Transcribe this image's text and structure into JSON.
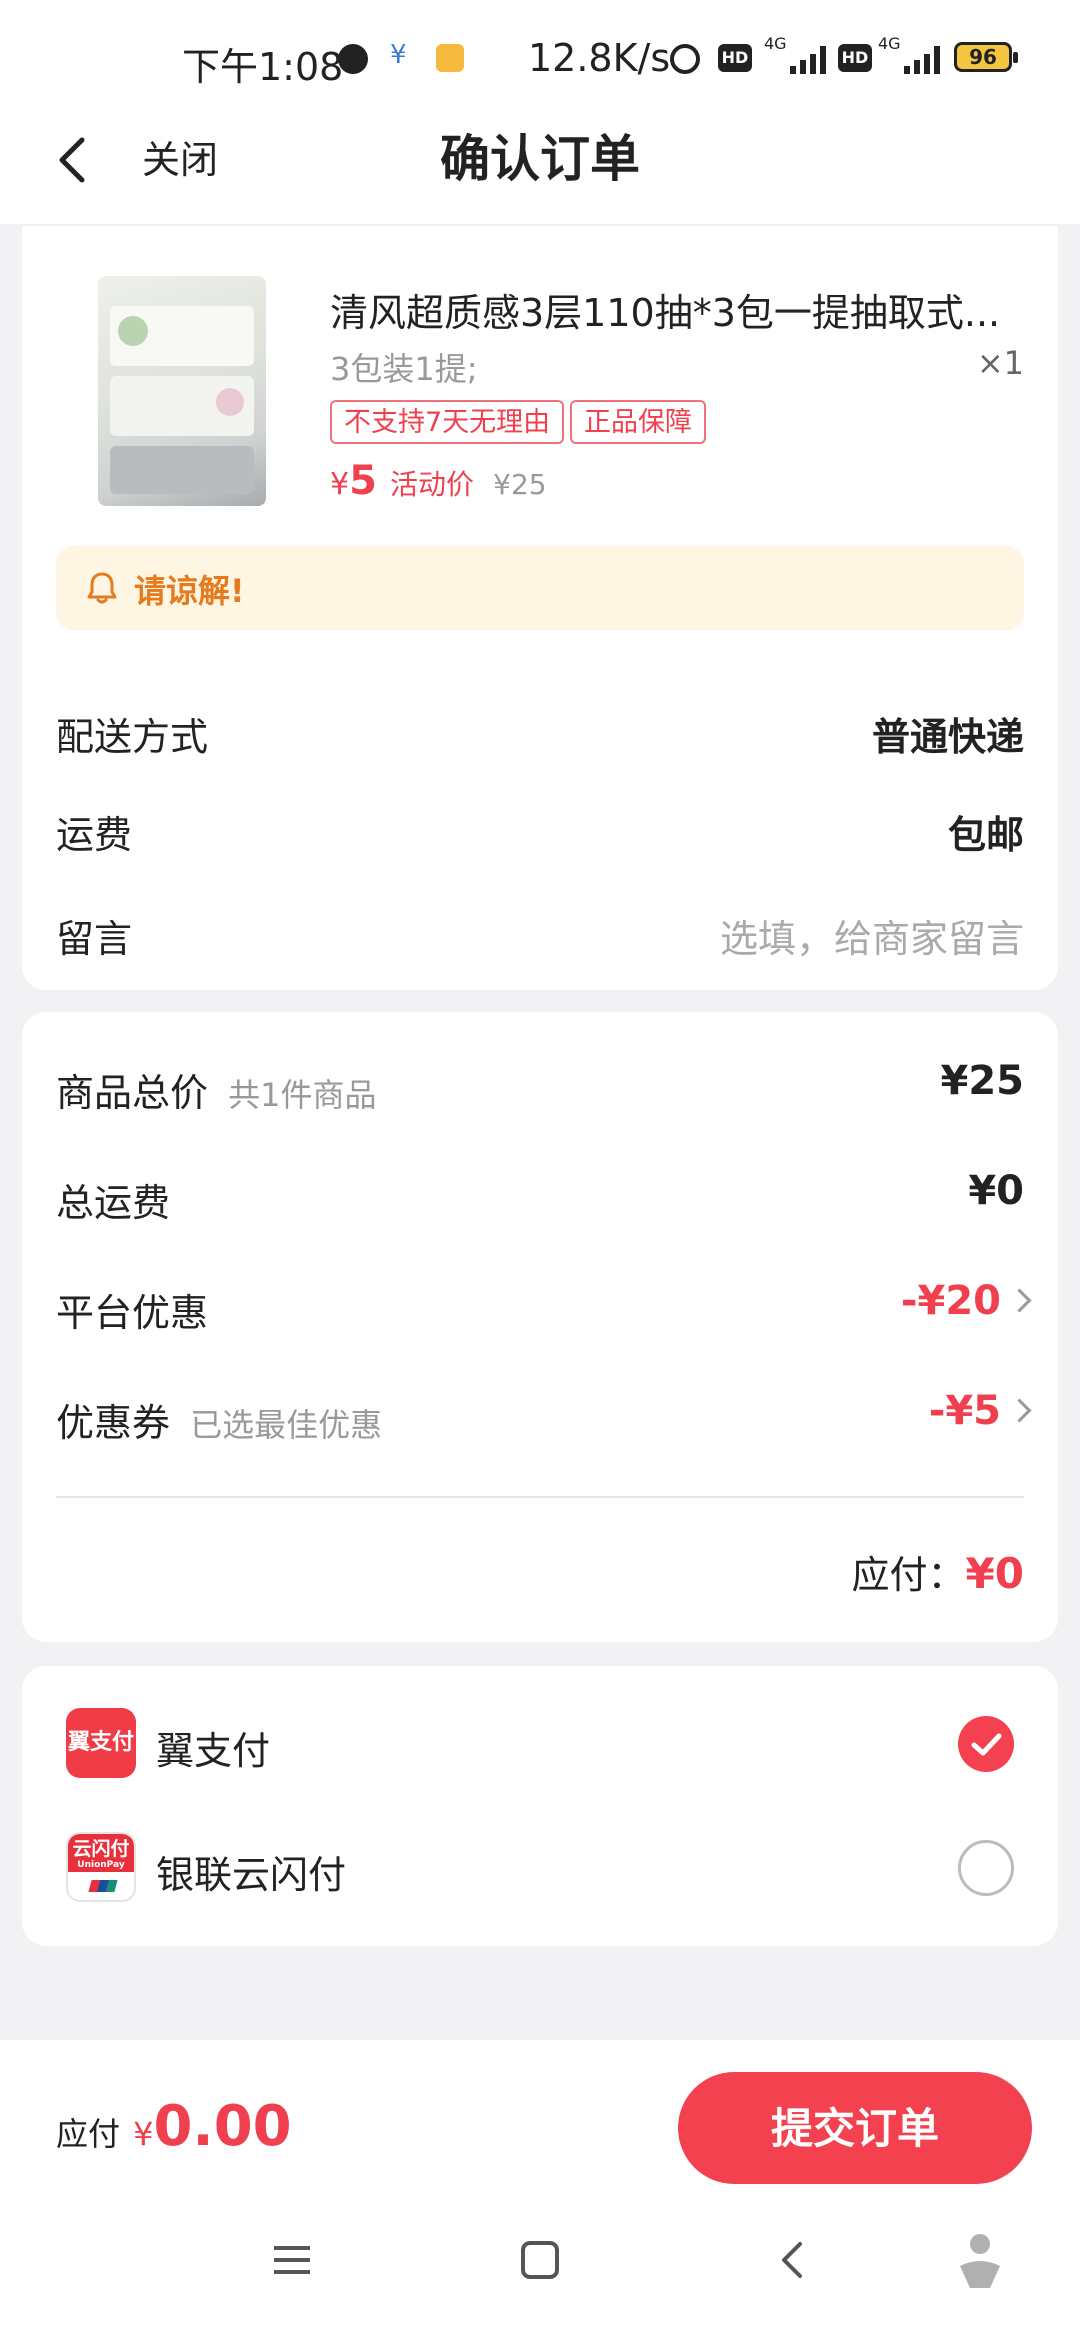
{
  "status_bar": {
    "time": "下午1:08",
    "net_speed": "12.8K/s",
    "hd1": "HD",
    "hd2": "HD",
    "net1": "4G",
    "net2": "4G",
    "battery": "96"
  },
  "nav": {
    "close_label": "关闭",
    "title": "确认订单"
  },
  "order": {
    "product_title": "清风超质感3层110抽*3包一提抽取式...",
    "spec": "3包装1提;",
    "quantity": "×1",
    "tags": [
      "不支持7天无理由",
      "正品保障"
    ],
    "price_symbol": "¥",
    "price_value": "5",
    "price_tag": "活动价",
    "original_price": "¥25",
    "notice_text": "请谅解!"
  },
  "shipping": {
    "method_label": "配送方式",
    "method_value": "普通快递",
    "fee_label": "运费",
    "fee_value": "包邮",
    "message_label": "留言",
    "message_placeholder": "选填，给商家留言"
  },
  "summary": {
    "goods_total_label": "商品总价",
    "goods_count": "共1件商品",
    "goods_total_value": "¥25",
    "shipping_total_label": "总运费",
    "shipping_total_value": "¥0",
    "platform_discount_label": "平台优惠",
    "platform_discount_value": "-¥20",
    "coupon_label": "优惠券",
    "coupon_note": "已选最佳优惠",
    "coupon_value": "-¥5",
    "payable_label": "应付：",
    "payable_value": "¥0"
  },
  "payment": {
    "methods": [
      {
        "label": "翼支付",
        "logo_text": "翼支付",
        "selected": true
      },
      {
        "label": "银联云闪付",
        "logo_text": "云闪付",
        "logo_sub": "UnionPay",
        "selected": false
      }
    ]
  },
  "bottom": {
    "payable_label": "应付",
    "currency": "¥",
    "amount": "0.00",
    "submit_label": "提交订单"
  },
  "colors": {
    "accent": "#f4414f",
    "notice_bg": "#fef5e3",
    "notice_text": "#e57b1d"
  }
}
